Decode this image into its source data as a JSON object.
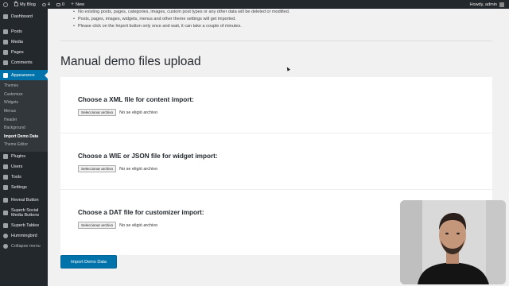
{
  "admin_bar": {
    "site_name": "My Blog",
    "updates_count": "4",
    "comments_count": "0",
    "new_label": "New",
    "greeting": "Howdy, admin"
  },
  "sidebar": {
    "items_top": [
      {
        "label": "Dashboard",
        "icon": "dashboard-icon"
      }
    ],
    "items_mid": [
      {
        "label": "Posts",
        "icon": "posts-icon"
      },
      {
        "label": "Media",
        "icon": "media-icon"
      },
      {
        "label": "Pages",
        "icon": "pages-icon"
      },
      {
        "label": "Comments",
        "icon": "comments-icon"
      }
    ],
    "active": {
      "label": "Appearance",
      "icon": "appearance-icon"
    },
    "submenu": [
      {
        "label": "Themes"
      },
      {
        "label": "Customize"
      },
      {
        "label": "Widgets"
      },
      {
        "label": "Menus"
      },
      {
        "label": "Header"
      },
      {
        "label": "Background"
      },
      {
        "label": "Import Demo Data"
      },
      {
        "label": "Theme Editor"
      }
    ],
    "items_bottom": [
      {
        "label": "Plugins",
        "icon": "plugins-icon"
      },
      {
        "label": "Users",
        "icon": "users-icon"
      },
      {
        "label": "Tools",
        "icon": "tools-icon"
      },
      {
        "label": "Settings",
        "icon": "settings-icon"
      }
    ],
    "items_extra": [
      {
        "label": "Reveal Button",
        "icon": "reveal-icon"
      },
      {
        "label": "Superb Social Media Buttons",
        "icon": "social-icon"
      },
      {
        "label": "Superb Tables",
        "icon": "tables-icon"
      },
      {
        "label": "Hummingbird",
        "icon": "hummingbird-icon"
      },
      {
        "label": "Collapse menu",
        "icon": "collapse-icon"
      }
    ]
  },
  "notes": [
    "No existing posts, pages, categories, images, custom post types or any other data will be deleted or modified.",
    "Posts, pages, images, widgets, menus and other theme settings will get imported.",
    "Please click on the Import button only once and wait, it can take a couple of minutes."
  ],
  "page_title": "Manual demo files upload",
  "sections": [
    {
      "heading": "Choose a XML file for content import:",
      "button": "Seleccionar archivo",
      "status": "No se eligió archivo"
    },
    {
      "heading": "Choose a WIE or JSON file for widget import:",
      "button": "Seleccionar archivo",
      "status": "No se eligió archivo"
    },
    {
      "heading": "Choose a DAT file for customizer import:",
      "button": "Seleccionar archivo",
      "status": "No se eligió archivo"
    }
  ],
  "import_button": "Import Demo Data",
  "colors": {
    "accent": "#0073aa",
    "sidebar": "#23282d"
  }
}
